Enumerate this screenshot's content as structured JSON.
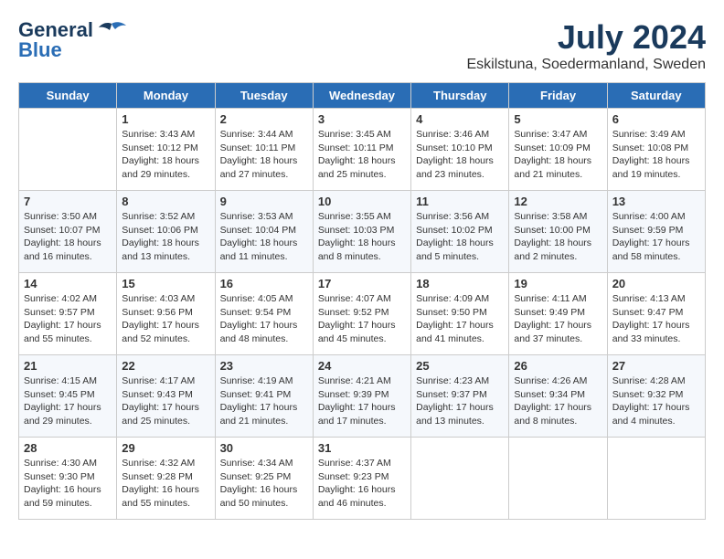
{
  "header": {
    "logo_line1": "General",
    "logo_line2": "Blue",
    "month": "July 2024",
    "location": "Eskilstuna, Soedermanland, Sweden"
  },
  "days_of_week": [
    "Sunday",
    "Monday",
    "Tuesday",
    "Wednesday",
    "Thursday",
    "Friday",
    "Saturday"
  ],
  "weeks": [
    [
      {
        "day": "",
        "info": ""
      },
      {
        "day": "1",
        "info": "Sunrise: 3:43 AM\nSunset: 10:12 PM\nDaylight: 18 hours and 29 minutes."
      },
      {
        "day": "2",
        "info": "Sunrise: 3:44 AM\nSunset: 10:11 PM\nDaylight: 18 hours and 27 minutes."
      },
      {
        "day": "3",
        "info": "Sunrise: 3:45 AM\nSunset: 10:11 PM\nDaylight: 18 hours and 25 minutes."
      },
      {
        "day": "4",
        "info": "Sunrise: 3:46 AM\nSunset: 10:10 PM\nDaylight: 18 hours and 23 minutes."
      },
      {
        "day": "5",
        "info": "Sunrise: 3:47 AM\nSunset: 10:09 PM\nDaylight: 18 hours and 21 minutes."
      },
      {
        "day": "6",
        "info": "Sunrise: 3:49 AM\nSunset: 10:08 PM\nDaylight: 18 hours and 19 minutes."
      }
    ],
    [
      {
        "day": "7",
        "info": "Sunrise: 3:50 AM\nSunset: 10:07 PM\nDaylight: 18 hours and 16 minutes."
      },
      {
        "day": "8",
        "info": "Sunrise: 3:52 AM\nSunset: 10:06 PM\nDaylight: 18 hours and 13 minutes."
      },
      {
        "day": "9",
        "info": "Sunrise: 3:53 AM\nSunset: 10:04 PM\nDaylight: 18 hours and 11 minutes."
      },
      {
        "day": "10",
        "info": "Sunrise: 3:55 AM\nSunset: 10:03 PM\nDaylight: 18 hours and 8 minutes."
      },
      {
        "day": "11",
        "info": "Sunrise: 3:56 AM\nSunset: 10:02 PM\nDaylight: 18 hours and 5 minutes."
      },
      {
        "day": "12",
        "info": "Sunrise: 3:58 AM\nSunset: 10:00 PM\nDaylight: 18 hours and 2 minutes."
      },
      {
        "day": "13",
        "info": "Sunrise: 4:00 AM\nSunset: 9:59 PM\nDaylight: 17 hours and 58 minutes."
      }
    ],
    [
      {
        "day": "14",
        "info": "Sunrise: 4:02 AM\nSunset: 9:57 PM\nDaylight: 17 hours and 55 minutes."
      },
      {
        "day": "15",
        "info": "Sunrise: 4:03 AM\nSunset: 9:56 PM\nDaylight: 17 hours and 52 minutes."
      },
      {
        "day": "16",
        "info": "Sunrise: 4:05 AM\nSunset: 9:54 PM\nDaylight: 17 hours and 48 minutes."
      },
      {
        "day": "17",
        "info": "Sunrise: 4:07 AM\nSunset: 9:52 PM\nDaylight: 17 hours and 45 minutes."
      },
      {
        "day": "18",
        "info": "Sunrise: 4:09 AM\nSunset: 9:50 PM\nDaylight: 17 hours and 41 minutes."
      },
      {
        "day": "19",
        "info": "Sunrise: 4:11 AM\nSunset: 9:49 PM\nDaylight: 17 hours and 37 minutes."
      },
      {
        "day": "20",
        "info": "Sunrise: 4:13 AM\nSunset: 9:47 PM\nDaylight: 17 hours and 33 minutes."
      }
    ],
    [
      {
        "day": "21",
        "info": "Sunrise: 4:15 AM\nSunset: 9:45 PM\nDaylight: 17 hours and 29 minutes."
      },
      {
        "day": "22",
        "info": "Sunrise: 4:17 AM\nSunset: 9:43 PM\nDaylight: 17 hours and 25 minutes."
      },
      {
        "day": "23",
        "info": "Sunrise: 4:19 AM\nSunset: 9:41 PM\nDaylight: 17 hours and 21 minutes."
      },
      {
        "day": "24",
        "info": "Sunrise: 4:21 AM\nSunset: 9:39 PM\nDaylight: 17 hours and 17 minutes."
      },
      {
        "day": "25",
        "info": "Sunrise: 4:23 AM\nSunset: 9:37 PM\nDaylight: 17 hours and 13 minutes."
      },
      {
        "day": "26",
        "info": "Sunrise: 4:26 AM\nSunset: 9:34 PM\nDaylight: 17 hours and 8 minutes."
      },
      {
        "day": "27",
        "info": "Sunrise: 4:28 AM\nSunset: 9:32 PM\nDaylight: 17 hours and 4 minutes."
      }
    ],
    [
      {
        "day": "28",
        "info": "Sunrise: 4:30 AM\nSunset: 9:30 PM\nDaylight: 16 hours and 59 minutes."
      },
      {
        "day": "29",
        "info": "Sunrise: 4:32 AM\nSunset: 9:28 PM\nDaylight: 16 hours and 55 minutes."
      },
      {
        "day": "30",
        "info": "Sunrise: 4:34 AM\nSunset: 9:25 PM\nDaylight: 16 hours and 50 minutes."
      },
      {
        "day": "31",
        "info": "Sunrise: 4:37 AM\nSunset: 9:23 PM\nDaylight: 16 hours and 46 minutes."
      },
      {
        "day": "",
        "info": ""
      },
      {
        "day": "",
        "info": ""
      },
      {
        "day": "",
        "info": ""
      }
    ]
  ]
}
